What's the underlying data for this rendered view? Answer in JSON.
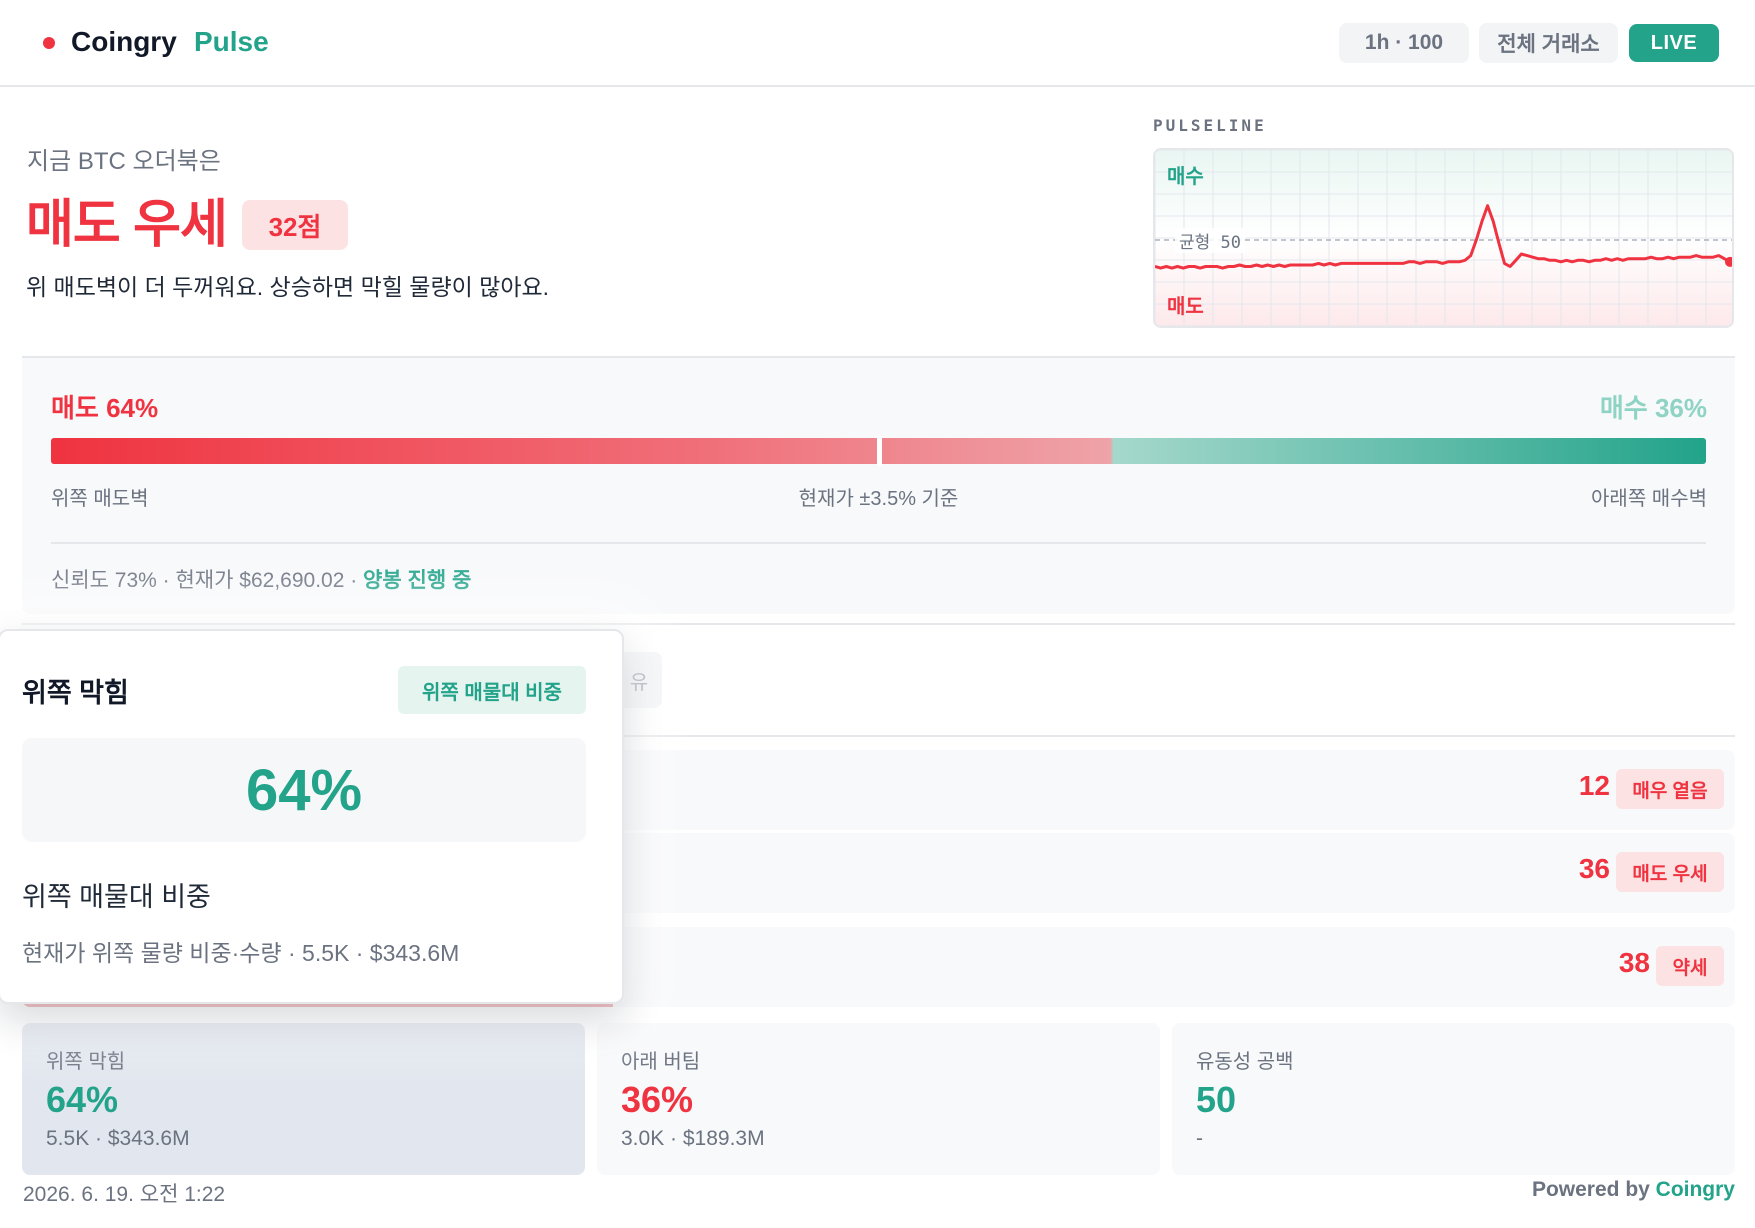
{
  "header": {
    "brand_name": "Coingry",
    "brand_sub": "Pulse",
    "range_label": "1h · 100",
    "exchange_label": "전체 거래소",
    "live_label": "LIVE"
  },
  "hero": {
    "label": "지금 BTC 오더북은",
    "title": "매도 우세",
    "score": "32점",
    "description": "위 매도벽이 더 두꺼워요. 상승하면 막힐 물량이 많아요."
  },
  "pulseline": {
    "label": "PULSELINE",
    "buy_label": "매수",
    "sell_label": "매도",
    "mid_label": "균형 50",
    "ylim": [
      0,
      100
    ],
    "values": [
      33,
      32,
      33,
      32,
      33,
      32,
      33,
      33,
      32,
      33,
      33,
      33,
      32,
      33,
      33,
      34,
      33,
      33,
      34,
      33,
      34,
      33,
      34,
      33,
      34,
      34,
      34,
      34,
      34,
      35,
      34,
      35,
      34,
      35,
      35,
      35,
      35,
      35,
      35,
      35,
      35,
      35,
      35,
      35,
      35,
      36,
      36,
      35,
      36,
      36,
      36,
      35,
      36,
      36,
      36,
      37,
      40,
      50,
      62,
      72,
      62,
      48,
      35,
      33,
      37,
      41,
      40,
      39,
      38,
      38,
      37,
      37,
      36,
      37,
      36,
      37,
      37,
      36,
      37,
      37,
      38,
      37,
      38,
      37,
      38,
      38,
      38,
      38,
      39,
      38,
      38,
      39,
      38,
      39,
      39,
      39,
      40,
      39,
      39,
      39,
      40,
      38,
      36
    ],
    "colors": {
      "line": "#ef3340",
      "buy": "#22a38a",
      "sell": "#ef3340"
    }
  },
  "gauge": {
    "sell_label": "매도 64%",
    "buy_label": "매수 36%",
    "sell_pct": 64,
    "buy_pct": 36,
    "marker_pct": 50,
    "left_caption": "위쪽 매도벽",
    "center_caption": "현재가 ±3.5% 기준",
    "right_caption": "아래쪽 매수벽",
    "meta": "신뢰도 73% · 현재가 $62,690.02 · ",
    "trend": "양봉 진행 중"
  },
  "tabs": {
    "ghost_label": "유"
  },
  "rows": [
    {
      "score": "12",
      "badge": "매우 옅음",
      "fill_pct": 0
    },
    {
      "score": "36",
      "badge": "매도 우세",
      "fill_pct": 32.5
    },
    {
      "score": "38",
      "badge": "약세",
      "fill_pct": 34.5
    }
  ],
  "stats": [
    {
      "label": "위쪽 막힘",
      "value": "64%",
      "sub": "5.5K · $343.6M",
      "color": "#22a38a",
      "active": true
    },
    {
      "label": "아래 버팀",
      "value": "36%",
      "sub": "3.0K · $189.3M",
      "color": "#ef3340",
      "active": false
    },
    {
      "label": "유동성 공백",
      "value": "50",
      "sub": "-",
      "color": "#22a38a",
      "active": false
    }
  ],
  "tooltip": {
    "title": "위쪽 막힘",
    "badge": "위쪽 매물대 비중",
    "value": "64%",
    "heading": "위쪽 매물대 비중",
    "detail": "현재가 위쪽 물량 비중·수량 · 5.5K · $343.6M"
  },
  "footer": {
    "date": "2026. 6. 19. 오전 1:22",
    "powered_prefix": "Powered by ",
    "powered_brand": "Coingry"
  }
}
